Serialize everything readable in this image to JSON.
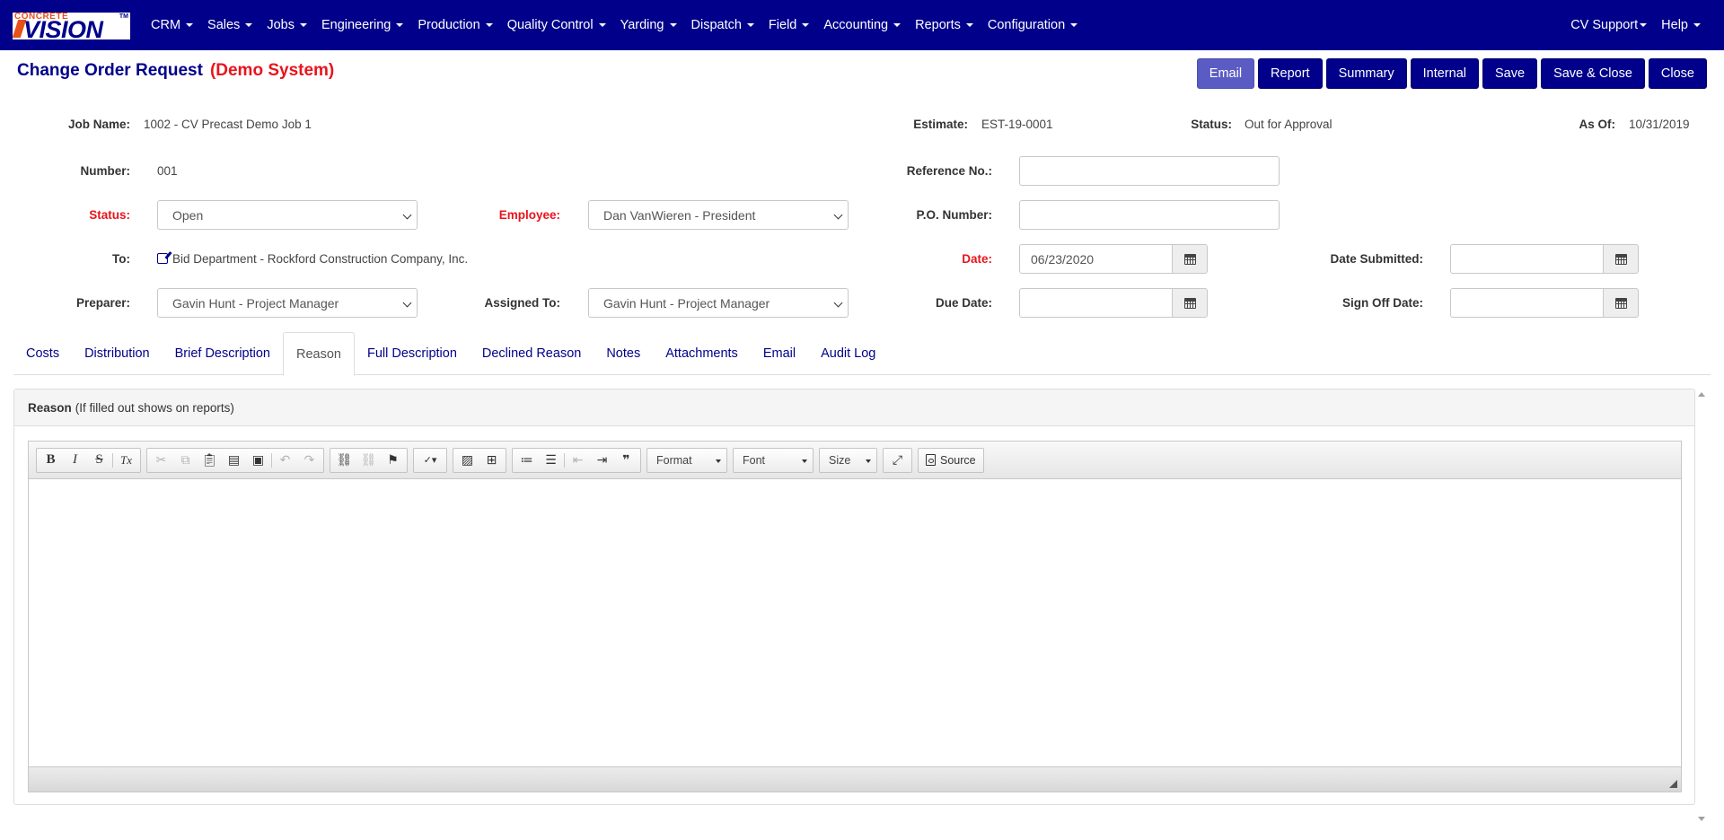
{
  "brand": {
    "logo_top": "CONCRETE",
    "logo_main": "VISION",
    "logo_tm": "TM"
  },
  "nav": {
    "items": [
      "CRM",
      "Sales",
      "Jobs",
      "Engineering",
      "Production",
      "Quality Control",
      "Yarding",
      "Dispatch",
      "Field",
      "Accounting",
      "Reports",
      "Configuration"
    ],
    "right": [
      "CV Support",
      "Help"
    ]
  },
  "page": {
    "title": "Change Order Request",
    "demo_label": "(Demo System)"
  },
  "actions": {
    "email": "Email",
    "report": "Report",
    "summary": "Summary",
    "internal": "Internal",
    "save": "Save",
    "save_close": "Save & Close",
    "close": "Close"
  },
  "info": {
    "job_name_label": "Job Name:",
    "job_name": "1002 - CV Precast Demo Job 1",
    "estimate_label": "Estimate:",
    "estimate": "EST-19-0001",
    "status_label": "Status:",
    "status": "Out for Approval",
    "as_of_label": "As Of:",
    "as_of": "10/31/2019"
  },
  "form": {
    "number_label": "Number:",
    "number": "001",
    "reference_label": "Reference No.:",
    "reference": "",
    "status_label": "Status:",
    "status": "Open",
    "employee_label": "Employee:",
    "employee": "Dan VanWieren - President",
    "po_label": "P.O. Number:",
    "po": "",
    "to_label": "To:",
    "to": "Bid Department - Rockford Construction Company, Inc.",
    "date_label": "Date:",
    "date": "06/23/2020",
    "date_submitted_label": "Date Submitted:",
    "date_submitted": "",
    "preparer_label": "Preparer:",
    "preparer": "Gavin Hunt - Project Manager",
    "assigned_label": "Assigned To:",
    "assigned": "Gavin Hunt - Project Manager",
    "due_date_label": "Due Date:",
    "due_date": "",
    "sign_off_label": "Sign Off Date:",
    "sign_off": ""
  },
  "tabs": [
    "Costs",
    "Distribution",
    "Brief Description",
    "Reason",
    "Full Description",
    "Declined Reason",
    "Notes",
    "Attachments",
    "Email",
    "Audit Log"
  ],
  "active_tab": "Reason",
  "panel": {
    "heading_bold": "Reason",
    "heading_note": "(If filled out shows on reports)"
  },
  "editor": {
    "toolbar": {
      "bold": "B",
      "italic": "I",
      "strike": "S",
      "remove_format": "Tx",
      "format": "Format",
      "font": "Font",
      "size": "Size",
      "source": "Source"
    }
  },
  "colors": {
    "navbar": "#00008b",
    "required": "#e8141b",
    "button": "#00008b",
    "email_button": "#5b5bc4"
  }
}
